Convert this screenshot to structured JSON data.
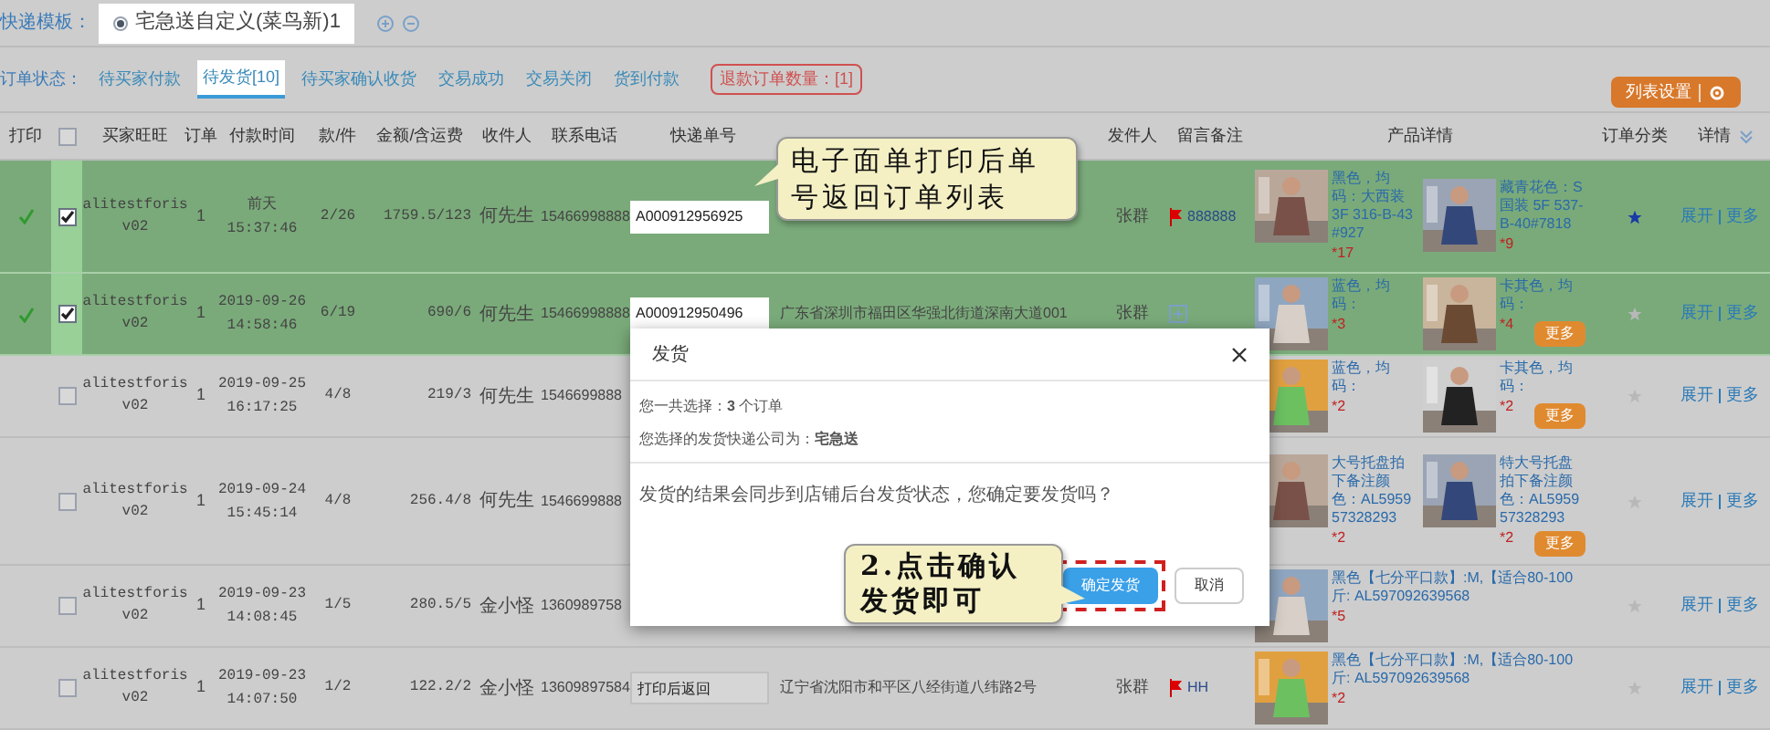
{
  "template": {
    "label": "快递模板：",
    "option": {
      "text": "宅急送自定义(菜鸟新)1",
      "selected": true
    }
  },
  "status": {
    "label": "订单状态：",
    "tabs": [
      {
        "label": "待买家付款",
        "selected": false
      },
      {
        "label": "待发货[10]",
        "selected": true
      },
      {
        "label": "待买家确认收货",
        "selected": false
      },
      {
        "label": "交易成功",
        "selected": false
      },
      {
        "label": "交易关闭",
        "selected": false
      },
      {
        "label": "货到付款",
        "selected": false
      }
    ],
    "refund": "退款订单数量：[1]"
  },
  "list_settings": "列表设置",
  "header": {
    "print": "打印",
    "checked": false,
    "buyer": "买家旺旺",
    "order": "订单",
    "time": "付款时间",
    "items": "款/件",
    "amount": "金额/含运费",
    "receiver": "收件人",
    "phone": "联系电话",
    "tracking": "快递单号",
    "sender": "发件人",
    "note": "留言备注",
    "products": "产品详情",
    "category": "订单分类",
    "detail": "详情"
  },
  "rows": [
    {
      "printed": true,
      "checked": true,
      "buyer": "alitestforisv02",
      "order": "1",
      "date": "前天",
      "time": "15:37:46",
      "items": "2/26",
      "amount": "1759.5/123",
      "receiver": "何先生",
      "phone": "15466998888",
      "tracking": "A000912956925",
      "sender": "张群",
      "note": {
        "kind": "flag",
        "text": "888888"
      },
      "products": [
        {
          "text": "黑色，均码：大西装 3F 316-B-43#927",
          "qty": "*17"
        },
        {
          "text": "藏青花色：S 国装 5F 537-B-40#7818",
          "qty": "*9"
        }
      ],
      "starred": true,
      "actions": [
        "展开",
        "更多"
      ]
    },
    {
      "printed": true,
      "checked": true,
      "buyer": "alitestforisv02",
      "order": "1",
      "date": "2019-09-26",
      "time": "14:58:46",
      "items": "6/19",
      "amount": "690/6",
      "receiver": "何先生",
      "phone": "15466998888",
      "tracking": "A000912950496",
      "address": "广东省深圳市福田区华强北街道深南大道001",
      "sender": "张群",
      "note": {
        "kind": "add"
      },
      "products": [
        {
          "text": "蓝色，均码：",
          "qty": "*3"
        },
        {
          "text": "卡其色，均码：",
          "qty": "*4"
        }
      ],
      "more": "更多",
      "starred": false,
      "actions": [
        "展开",
        "更多"
      ]
    },
    {
      "printed": false,
      "checked": false,
      "buyer": "alitestforisv02",
      "order": "1",
      "date": "2019-09-25",
      "time": "16:17:25",
      "items": "4/8",
      "amount": "219/3",
      "receiver": "何先生",
      "phone": "1546699888",
      "products": [
        {
          "text": "蓝色，均码：",
          "qty": "*2"
        },
        {
          "text": "卡其色，均码：",
          "qty": "*2"
        }
      ],
      "more": "更多",
      "starred": false,
      "actions": [
        "展开",
        "更多"
      ]
    },
    {
      "printed": false,
      "checked": false,
      "buyer": "alitestforisv02",
      "order": "1",
      "date": "2019-09-24",
      "time": "15:45:14",
      "items": "4/8",
      "amount": "256.4/8",
      "receiver": "何先生",
      "phone": "1546699888",
      "products": [
        {
          "text": "大号托盘拍下备注颜色：AL595957328293",
          "qty": "*2"
        },
        {
          "text": "特大号托盘拍下备注颜色：AL595957328293",
          "qty": "*2"
        }
      ],
      "more": "更多",
      "starred": false,
      "actions": [
        "展开",
        "更多"
      ]
    },
    {
      "printed": false,
      "checked": false,
      "buyer": "alitestforisv02",
      "order": "1",
      "date": "2019-09-23",
      "time": "14:08:45",
      "items": "1/5",
      "amount": "280.5/5",
      "receiver": "金小怪",
      "phone": "1360989758",
      "products": [
        {
          "text": "黑色【七分平口款】:M,【适合80-100斤: AL597092639568",
          "qty": "*5"
        }
      ],
      "starred": false,
      "actions": [
        "展开",
        "更多"
      ]
    },
    {
      "printed": false,
      "checked": false,
      "buyer": "alitestforisv02",
      "order": "1",
      "date": "2019-09-23",
      "time": "14:07:50",
      "items": "1/2",
      "amount": "122.2/2",
      "receiver": "金小怪",
      "phone": "13609897584",
      "tracking": "打印后返回",
      "address": "辽宁省沈阳市和平区八经街道八纬路2号",
      "sender": "张群",
      "note": {
        "kind": "flag",
        "text": "HH"
      },
      "products": [
        {
          "text": "黑色【七分平口款】:M,【适合80-100斤: AL597092639568",
          "qty": "*2"
        }
      ],
      "starred": false,
      "actions": [
        "展开",
        "更多"
      ]
    }
  ],
  "dialog": {
    "title": "发货",
    "count_line": "您一共选择：**3** 个订单",
    "company_line": "您选择的发货快递公司为：**宅急送**",
    "message": "发货的结果会同步到店铺后台发货状态，您确定要发货吗？",
    "confirm": "确定发货",
    "cancel": "取消"
  },
  "callouts": [
    "电子面单打印后单号返回订单列表",
    "2.点击确认发货即可"
  ]
}
